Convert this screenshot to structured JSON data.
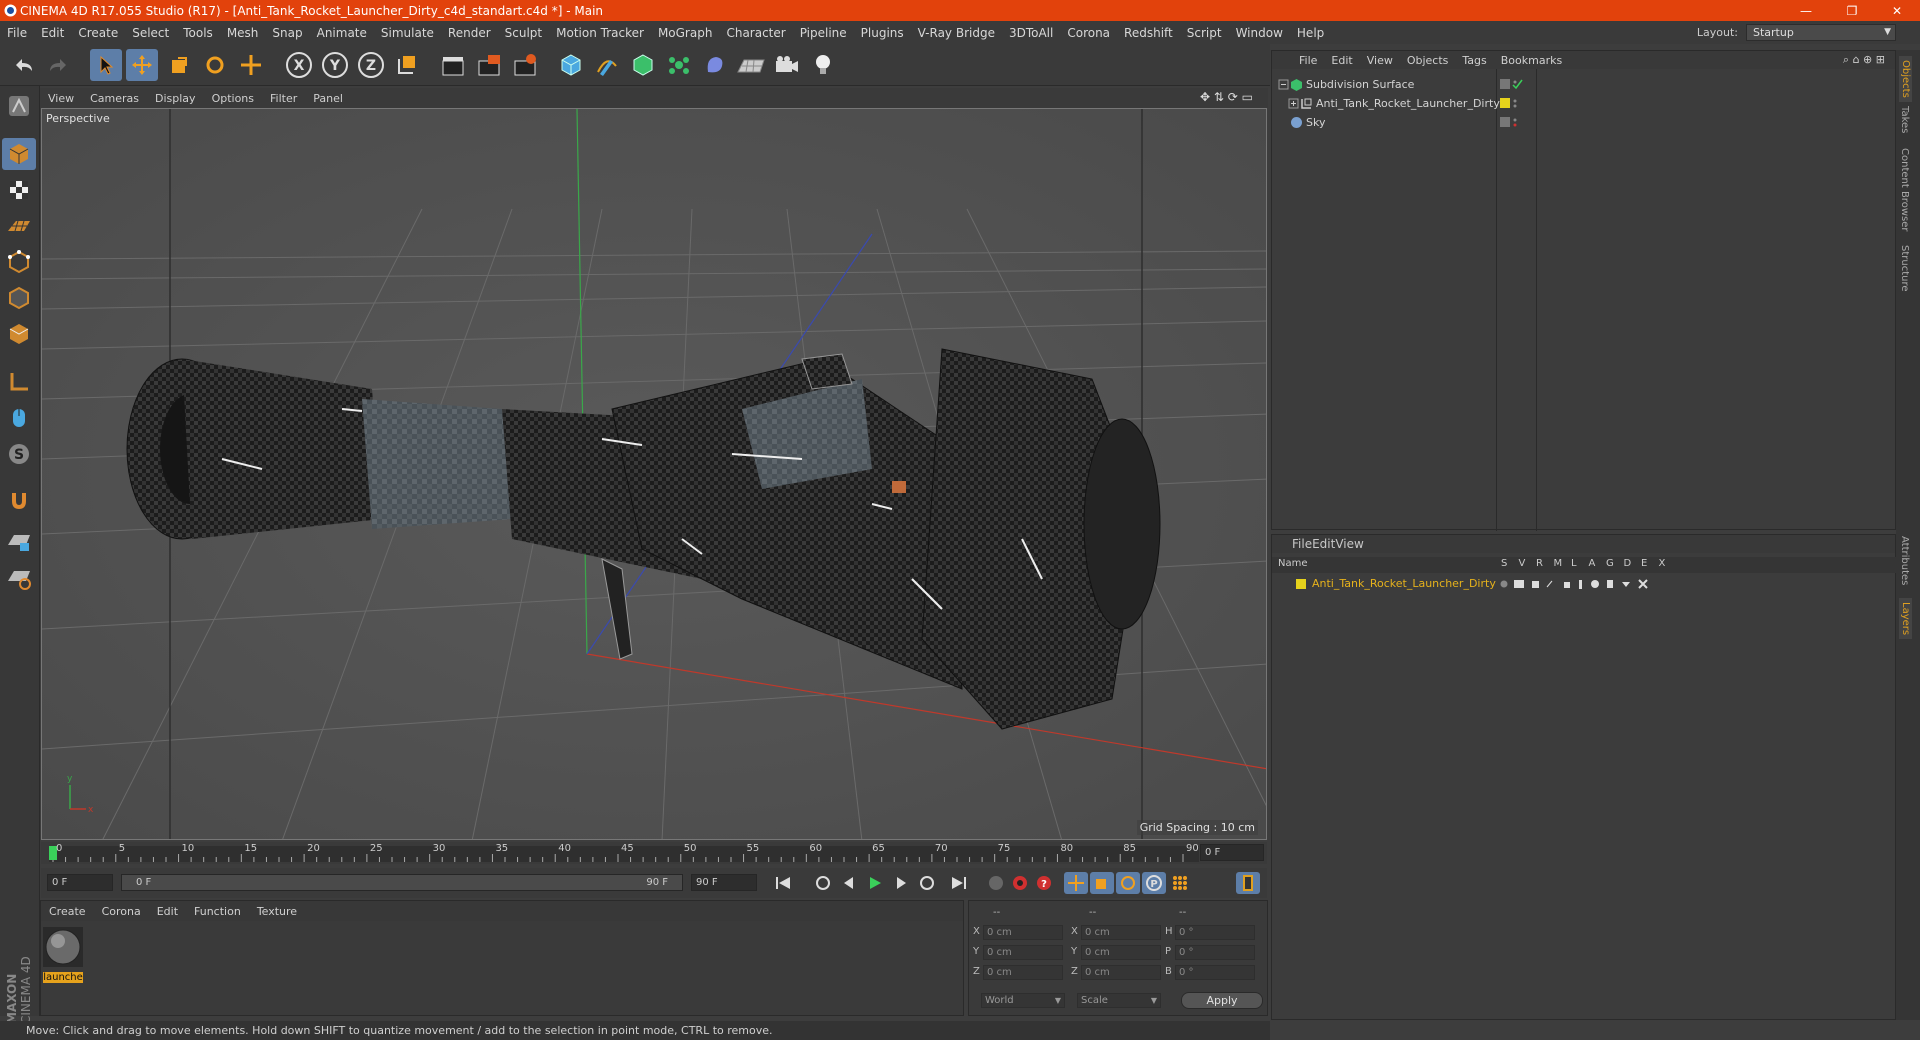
{
  "window": {
    "title": "CINEMA 4D R17.055 Studio (R17) - [Anti_Tank_Rocket_Launcher_Dirty_c4d_standart.c4d *] - Main",
    "minimize": "—",
    "restore": "❐",
    "close": "✕"
  },
  "menu": [
    "File",
    "Edit",
    "Create",
    "Select",
    "Tools",
    "Mesh",
    "Snap",
    "Animate",
    "Simulate",
    "Render",
    "Sculpt",
    "Motion Tracker",
    "MoGraph",
    "Character",
    "Pipeline",
    "Plugins",
    "V-Ray Bridge",
    "3DToAll",
    "Corona",
    "Redshift",
    "Script",
    "Window",
    "Help"
  ],
  "layout": {
    "label": "Layout:",
    "value": "Startup"
  },
  "viewport": {
    "menu": [
      "View",
      "Cameras",
      "Display",
      "Options",
      "Filter",
      "Panel"
    ],
    "label": "Perspective",
    "grid_spacing": "Grid Spacing : 10 cm"
  },
  "timeline": {
    "ticks": [
      "0",
      "5",
      "10",
      "15",
      "20",
      "25",
      "30",
      "35",
      "40",
      "45",
      "50",
      "55",
      "60",
      "65",
      "70",
      "75",
      "80",
      "85",
      "90"
    ],
    "current_frame_field": "0 F",
    "start_field": "0 F",
    "range_start": "0 F",
    "range_end": "90 F",
    "end_field": "90 F"
  },
  "material_panel": {
    "menu": [
      "Create",
      "Corona",
      "Edit",
      "Function",
      "Texture"
    ],
    "material_name": "launche"
  },
  "coordinates": {
    "headers": [
      "--",
      "--",
      "--"
    ],
    "rows": [
      {
        "a": "X",
        "av": "0 cm",
        "b": "X",
        "bv": "0 cm",
        "c": "H",
        "cv": "0 °"
      },
      {
        "a": "Y",
        "av": "0 cm",
        "b": "Y",
        "bv": "0 cm",
        "c": "P",
        "cv": "0 °"
      },
      {
        "a": "Z",
        "av": "0 cm",
        "b": "Z",
        "bv": "0 cm",
        "c": "B",
        "cv": "0 °"
      }
    ],
    "world": "World",
    "scale": "Scale",
    "apply": "Apply"
  },
  "status": "Move: Click and drag to move elements. Hold down SHIFT to quantize movement / add to the selection in point mode, CTRL to remove.",
  "objects_panel": {
    "menu": [
      "File",
      "Edit",
      "View",
      "Objects",
      "Tags",
      "Bookmarks"
    ],
    "items": [
      {
        "name": "Subdivision Surface",
        "icon": "subdivision-icon"
      },
      {
        "name": "Anti_Tank_Rocket_Launcher_Dirty",
        "icon": "null-object-icon"
      },
      {
        "name": "Sky",
        "icon": "sky-icon"
      }
    ]
  },
  "layers_panel": {
    "menu": [
      "File",
      "Edit",
      "View"
    ],
    "name_header": "Name",
    "columns": [
      "S",
      "V",
      "R",
      "M",
      "L",
      "A",
      "G",
      "D",
      "E",
      "X"
    ],
    "layer_name": "Anti_Tank_Rocket_Launcher_Dirty",
    "layer_color": "#e6d21c"
  },
  "right_tabs": [
    "Objects",
    "Takes",
    "Content Browser",
    "Structure",
    "Attributes",
    "Layers"
  ],
  "brand": {
    "maxon": "MAXON",
    "product": "CINEMA 4D"
  },
  "colors": {
    "titlebar": "#e2420c",
    "accent_blue": "#5d7ea8",
    "x_axis": "#c0392b",
    "y_axis": "#3aa84a",
    "z_axis": "#3a4ab0"
  }
}
